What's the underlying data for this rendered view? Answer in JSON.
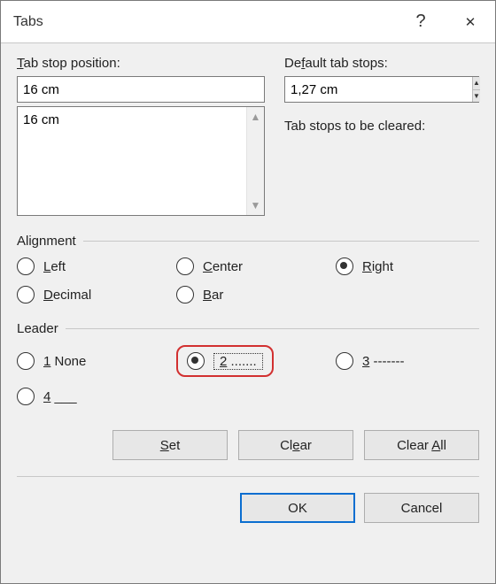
{
  "title": "Tabs",
  "labels": {
    "tab_stop_position": "ab stop position:",
    "tab_stop_position_u": "T",
    "default_tab_stops": "De",
    "default_tab_stops_u": "f",
    "default_tab_stops_rest": "ault tab stops:",
    "cleared": "Tab stops to be cleared:",
    "alignment": "Alignment",
    "leader": "Leader"
  },
  "inputs": {
    "position_value": "16 cm",
    "default_value": "1,27 cm"
  },
  "list_items": [
    "16 cm"
  ],
  "alignment": {
    "left_u": "L",
    "left": "eft",
    "center_u": "C",
    "center": "enter",
    "right_u": "R",
    "right": "ight",
    "decimal_u": "D",
    "decimal": "ecimal",
    "bar_u": "B",
    "bar": "ar",
    "selected": "right"
  },
  "leader": {
    "opt1_u": "1",
    "opt1": " None",
    "opt2_u": "2",
    "opt2": " .......",
    "opt3_u": "3",
    "opt3": " -------",
    "opt4_u": "4",
    "opt4": " ___",
    "selected": "2"
  },
  "buttons": {
    "set_u": "S",
    "set": "et",
    "clear_u": "e",
    "clear_pre": "Cl",
    "clear_post": "ar",
    "clearall_u": "A",
    "clearall_pre": "Clear ",
    "clearall_post": "ll",
    "ok": "OK",
    "cancel": "Cancel"
  }
}
